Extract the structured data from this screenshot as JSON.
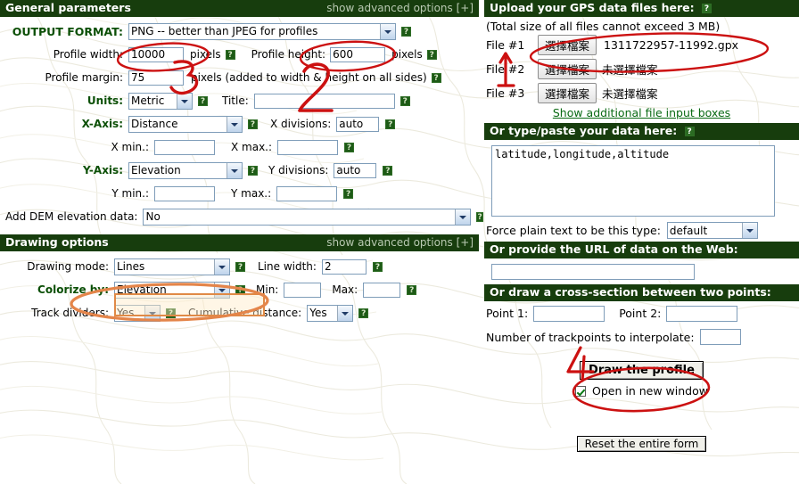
{
  "colors": {
    "header_bar": "#173d0d",
    "header_text": "#ffffff",
    "advanced_text": "#b9c9b2",
    "label_bold": "#0b4f06",
    "link": "#0a6a14",
    "annotation_red": "#cc0000",
    "annotation_orange": "#e4854a",
    "input_border": "#7f9db9"
  },
  "general": {
    "title": "General parameters",
    "advanced": "show advanced options [+]",
    "output_format_label": "OUTPUT FORMAT:",
    "output_format_value": "PNG -- better than JPEG for profiles",
    "profile_width_label": "Profile width:",
    "profile_width_value": "10000",
    "pixels_1": "pixels",
    "profile_height_label": "Profile height:",
    "profile_height_value": "600",
    "pixels_2": "pixels",
    "profile_margin_label": "Profile margin:",
    "profile_margin_value": "75",
    "margin_note": "pixels (added to width & height on all sides)",
    "units_label": "Units:",
    "units_value": "Metric",
    "title_label": "Title:",
    "title_value": "",
    "xaxis_label": "X-Axis:",
    "xaxis_value": "Distance",
    "xdiv_label": "X divisions:",
    "xdiv_value": "auto",
    "xmin_label": "X min.:",
    "xmin_value": "",
    "xmax_label": "X max.:",
    "xmax_value": "",
    "yaxis_label": "Y-Axis:",
    "yaxis_value": "Elevation",
    "ydiv_label": "Y divisions:",
    "ydiv_value": "auto",
    "ymin_label": "Y min.:",
    "ymin_value": "",
    "ymax_label": "Y max.:",
    "ymax_value": "",
    "dem_label": "Add DEM elevation data:",
    "dem_value": "No",
    "help_icon": "question-mark-icon"
  },
  "drawing": {
    "title": "Drawing options",
    "advanced": "show advanced options [+]",
    "mode_label": "Drawing mode:",
    "mode_value": "Lines",
    "linewidth_label": "Line width:",
    "linewidth_value": "2",
    "colorize_label": "Colorize by:",
    "colorize_value": "Elevation",
    "min_label": "Min:",
    "min_value": "",
    "max_label": "Max:",
    "max_value": "",
    "dividers_label": "Track dividers:",
    "dividers_value": "Yes",
    "cumulative_label": "Cumulative distance:",
    "cumulative_value": "Yes"
  },
  "upload": {
    "title": "Upload your GPS data files here:",
    "note": "(Total size of all files cannot exceed 3 MB)",
    "files": [
      {
        "label": "File #1",
        "button": "選擇檔案",
        "status": "1311722957-11992.gpx"
      },
      {
        "label": "File #2",
        "button": "選擇檔案",
        "status": "未選擇檔案"
      },
      {
        "label": "File #3",
        "button": "選擇檔案",
        "status": "未選擇檔案"
      }
    ],
    "more_link": "Show additional file input boxes"
  },
  "paste": {
    "title": "Or type/paste your data here:",
    "textarea_value": "latitude,longitude,altitude",
    "force_label": "Force plain text to be this type:",
    "force_value": "default"
  },
  "url": {
    "title": "Or provide the URL of data on the Web:",
    "value": ""
  },
  "cross": {
    "title": "Or draw a cross-section between two points:",
    "point1_label": "Point 1:",
    "point1_value": "",
    "point2_label": "Point 2:",
    "point2_value": "",
    "interp_label": "Number of trackpoints to interpolate:",
    "interp_value": ""
  },
  "actions": {
    "draw_button": "Draw the profile",
    "open_new_window": "Open in new window",
    "open_new_window_checked": true,
    "reset_button": "Reset the entire form"
  },
  "annotations": {
    "marks": [
      "1",
      "2",
      "3",
      "4"
    ],
    "ellipse_targets": [
      "profile-width-field",
      "profile-height-field",
      "file-1-row",
      "colorize-by-select",
      "draw-the-profile-button"
    ]
  }
}
